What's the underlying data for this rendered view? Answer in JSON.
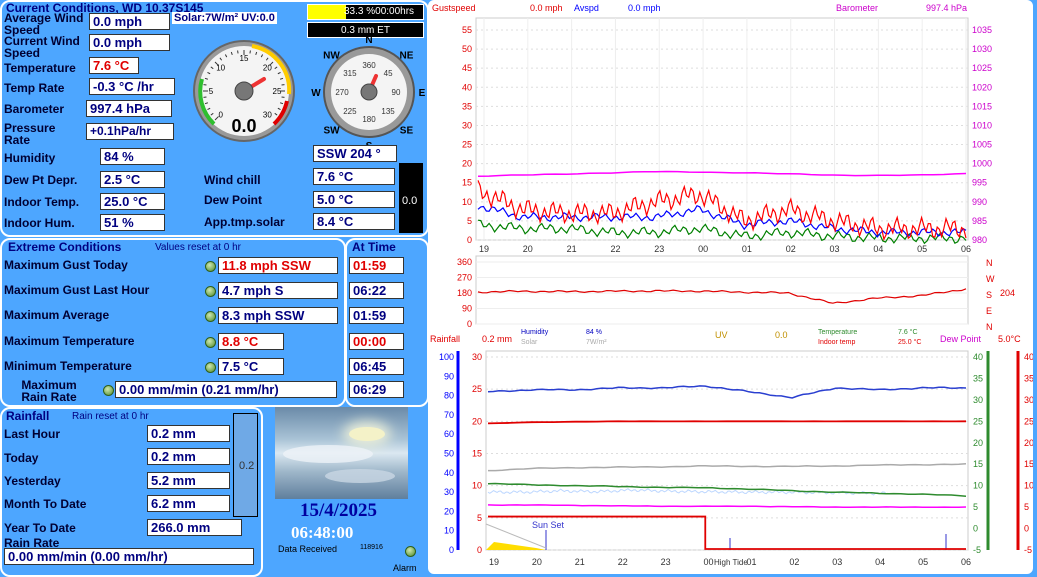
{
  "current": {
    "title": "Current Conditions, WD 10.37S145",
    "solar_uv": "Solar:7W/m² UV:0.0",
    "sun_box": "33.3 %00:00hrs",
    "et_box": "0.3 mm ET",
    "labels": {
      "avg_wind": "Average Wind Speed",
      "cur_wind": "Current Wind Speed",
      "temp": "Temperature",
      "temp_rate": "Temp Rate",
      "baro": "Barometer",
      "press_rate": "Pressure Rate",
      "humidity": "Humidity",
      "dew_depr": "Dew Pt Depr.",
      "indoor_temp": "Indoor Temp.",
      "indoor_hum": "Indoor Hum.",
      "wind_chill": "Wind chill",
      "dew_point": "Dew Point",
      "app_temp": "App.tmp.solar"
    },
    "values": {
      "avg_wind": "0.0 mph",
      "cur_wind": "0.0 mph",
      "temp": "7.6 °C",
      "temp_rate": "-0.3 °C /hr",
      "baro": "997.4 hPa",
      "press_rate": "+0.1hPa/hr",
      "humidity": "84 %",
      "dew_depr": "2.5 °C",
      "indoor_temp": "25.0 °C",
      "indoor_hum": "51 %",
      "wind_chill": "7.6 °C",
      "dew_point": "5.0 °C",
      "app_temp": "8.4 °C"
    },
    "gauge_value": "0.0",
    "gauge_ticks": [
      "0",
      "5",
      "10",
      "15",
      "20",
      "25",
      "30"
    ],
    "compass_points": [
      "N",
      "NE",
      "E",
      "SE",
      "S",
      "SW",
      "W",
      "NW"
    ],
    "compass_degrees": [
      "360",
      "45",
      "90",
      "135",
      "180",
      "225",
      "270",
      "315"
    ],
    "wind_dir": "SSW  204 °",
    "black_meter_value": "0.0"
  },
  "extreme": {
    "title": "Extreme Conditions",
    "reset_note": "Values reset at 0 hr",
    "at_time_title": "At Time",
    "rows": [
      {
        "label": "Maximum Gust Today",
        "value": "11.8 mph SSW",
        "time": "01:59",
        "value_red": true,
        "time_red": true
      },
      {
        "label": "Maximum Gust Last Hour",
        "value": "4.7 mph   S",
        "time": "06:22",
        "value_red": false,
        "time_red": false
      },
      {
        "label": "Maximum Average",
        "value": "8.3 mph SSW",
        "time": "01:59",
        "value_red": false,
        "time_red": false
      },
      {
        "label": "Maximum Temperature",
        "value": "8.8 °C",
        "time": "00:00",
        "value_red": true,
        "time_red": true
      },
      {
        "label": "Minimum Temperature",
        "value": "7.5 °C",
        "time": "06:45",
        "value_red": false,
        "time_red": false
      },
      {
        "label": "Maximum Rain Rate",
        "value": "0.00 mm/min (0.21 mm/hr)",
        "time": "06:29",
        "value_red": false,
        "time_red": false
      }
    ]
  },
  "rainfall": {
    "title": "Rainfall",
    "reset_note": "Rain reset at 0 hr",
    "labels": {
      "last_hour": "Last Hour",
      "today": "Today",
      "yesterday": "Yesterday",
      "month": "Month To Date",
      "year": "Year To Date",
      "rate": "Rain Rate"
    },
    "values": {
      "last_hour": "0.2 mm",
      "today": "0.2 mm",
      "yesterday": "5.2 mm",
      "month": "6.2 mm",
      "year": "266.0 mm",
      "rate": "0.00 mm/min (0.00 mm/hr)"
    },
    "meter_value": "0.2"
  },
  "status": {
    "date": "15/4/2025",
    "time": "06:48:00",
    "data_received_label": "Data Received",
    "data_received_count": "118916",
    "alarm_label": "Alarm"
  },
  "chart_data": [
    {
      "type": "line",
      "header": {
        "gust_label": "Gustspeed",
        "gust_value": "0.0 mph",
        "avg_label": "Avspd",
        "avg_value": "0.0 mph",
        "baro_label": "Barometer",
        "baro_value": "997.4 hPa"
      },
      "x": [
        "19",
        "20",
        "21",
        "22",
        "23",
        "00",
        "01",
        "02",
        "03",
        "04",
        "05",
        "06"
      ],
      "y_left": [
        0,
        5,
        10,
        15,
        20,
        25,
        30,
        35,
        40,
        45,
        50,
        55
      ],
      "y_right": [
        980,
        985,
        990,
        995,
        1000,
        1005,
        1010,
        1015,
        1020,
        1025,
        1030,
        1035
      ],
      "series": [
        {
          "name": "Gustspeed",
          "color": "#ff0000",
          "values": [
            13,
            8,
            7,
            7,
            10,
            12,
            5,
            8,
            5,
            3,
            3,
            3
          ]
        },
        {
          "name": "Avspd",
          "color": "#0000ff",
          "values": [
            9,
            6,
            6,
            6,
            6,
            8,
            4,
            5,
            3,
            2,
            2,
            2
          ]
        },
        {
          "name": "Barometer",
          "color": "#ff00ff",
          "values": [
            996.7,
            997.0,
            997.3,
            997.6,
            997.9,
            997.8,
            997.6,
            997.3,
            997.0,
            996.9,
            997.0,
            997.4
          ]
        }
      ],
      "green_series_color": "#008000",
      "green_values": [
        4,
        3,
        3,
        2,
        2,
        3,
        1,
        2,
        1,
        0.5,
        0.5,
        0.5
      ]
    },
    {
      "type": "line",
      "x": [
        "19",
        "20",
        "21",
        "22",
        "23",
        "00",
        "01",
        "02",
        "03",
        "04",
        "05",
        "06"
      ],
      "y_ticks": [
        0,
        90,
        180,
        270,
        360
      ],
      "compass_labels": [
        "N",
        "W",
        "S",
        "E",
        "N"
      ],
      "current_value": "204",
      "series": [
        {
          "name": "Wind direction",
          "color": "#e00000",
          "values": [
            185,
            190,
            188,
            190,
            192,
            191,
            185,
            180,
            120,
            150,
            165,
            204
          ]
        }
      ]
    },
    {
      "type": "line",
      "header": {
        "rain_label": "Rainfall",
        "rain_value": "0.2 mm",
        "hum_label": "Humidity",
        "hum_value": "84 %",
        "solar_label": "Solar",
        "solar_value": "7W/m²",
        "uv_label": "UV",
        "uv_value": "0.0",
        "temp_label": "Temperature",
        "temp_value": "7.6 °C",
        "indoor_label": "Indoor temp",
        "indoor_value": "25.0 °C",
        "dew_label": "Dew Point",
        "dew_value": "5.0°C"
      },
      "x": [
        "19",
        "20",
        "21",
        "22",
        "23",
        "00",
        "01",
        "02",
        "03",
        "04",
        "05",
        "06"
      ],
      "y_left_pct": [
        0,
        10,
        20,
        30,
        40,
        50,
        60,
        70,
        80,
        90,
        100
      ],
      "y_rain": [
        0,
        5,
        10,
        15,
        20,
        25,
        30
      ],
      "y_temp": [
        -5,
        0,
        5,
        10,
        15,
        20,
        25,
        30,
        35,
        40
      ],
      "annotations": [
        "Sun Set",
        "High Tide"
      ],
      "series": [
        {
          "name": "Humidity",
          "color": "#2a3fd0",
          "values": [
            82,
            83,
            83,
            84,
            84,
            85,
            82,
            79,
            84,
            83,
            84,
            84
          ]
        },
        {
          "name": "Indoor temp",
          "color": "#e00000",
          "values": [
            24.5,
            24.8,
            24.9,
            25,
            25,
            25,
            25,
            25,
            25,
            25,
            25,
            25
          ]
        },
        {
          "name": "Grey",
          "color": "#aaaaaa",
          "values": [
            13.5,
            14,
            14.2,
            14.3,
            14.4,
            14.6,
            14.5,
            14.5,
            14.6,
            14.8,
            14.9,
            15
          ]
        },
        {
          "name": "Temperature",
          "color": "#2e8b2e",
          "values": [
            10.5,
            10.2,
            10,
            9.8,
            9.6,
            9.5,
            9.2,
            8.8,
            8.5,
            8.2,
            8,
            7.6
          ]
        },
        {
          "name": "Dew Point",
          "color": "#ff00ff",
          "values": [
            5.5,
            5.5,
            5.4,
            5.3,
            5.2,
            5.2,
            5.2,
            5.1,
            5,
            5,
            5,
            5
          ]
        },
        {
          "name": "Light",
          "color": "#bdd7ff",
          "values": [
            8.5,
            8.5,
            8.8,
            8.6,
            9,
            8.7,
            8.6,
            8.5,
            8.5,
            8.4,
            8.3,
            8.2
          ]
        },
        {
          "name": "Rainfall",
          "color": "#e00000",
          "values": [
            5.2,
            5.2,
            5.2,
            5.2,
            5.2,
            0.2,
            0.2,
            0.2,
            0.2,
            0.2,
            0.2,
            0.2
          ]
        }
      ]
    }
  ]
}
